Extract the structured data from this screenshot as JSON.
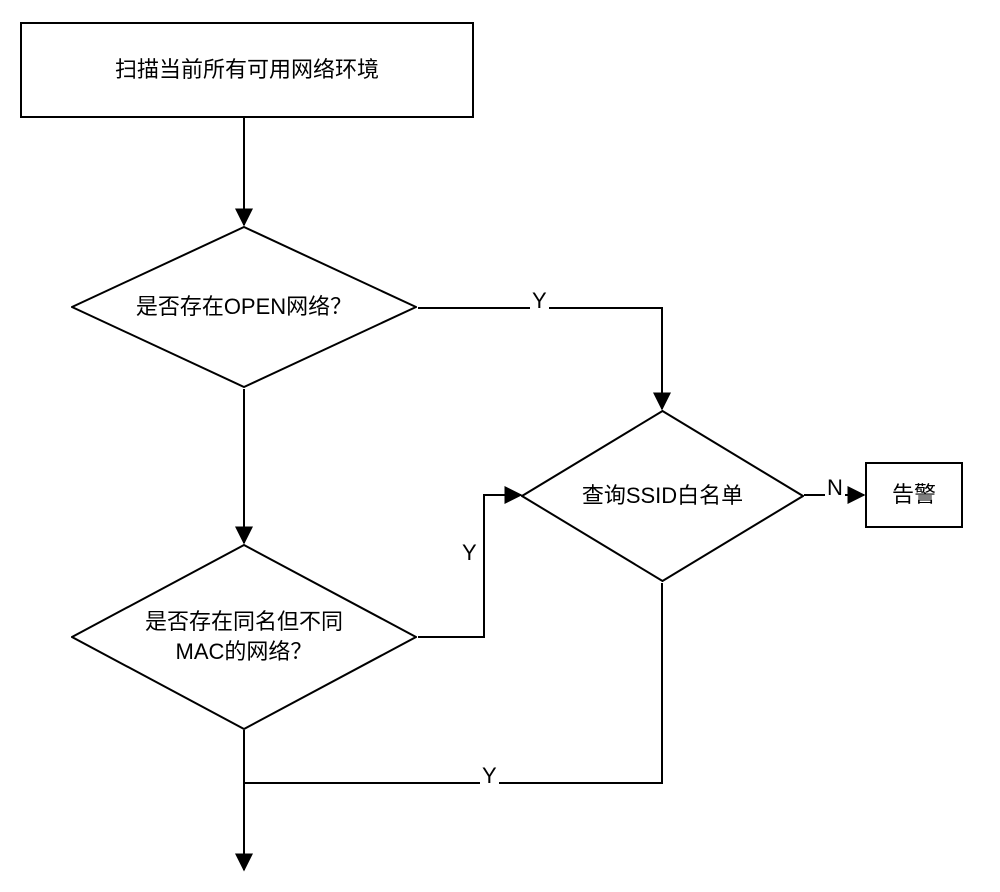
{
  "flow": {
    "start_box": "扫描当前所有可用网络环境",
    "decision_open": "是否存在OPEN网络？",
    "decision_same_name": "是否存在同名但不同\nMAC的网络？",
    "decision_ssid": "查询SSID白名单",
    "alarm_box": "告警",
    "labels": {
      "y1": "Y",
      "y2": "Y",
      "y3": "Y",
      "n": "N"
    }
  }
}
